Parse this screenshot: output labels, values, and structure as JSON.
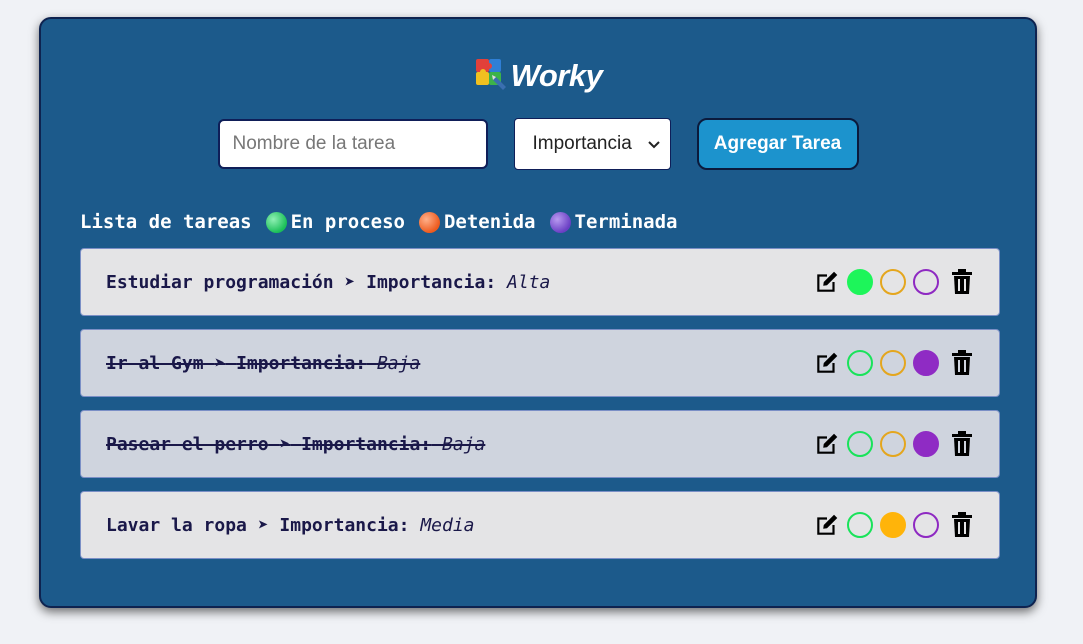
{
  "app": {
    "title": "Worky",
    "icon": "puzzle-logo-icon"
  },
  "form": {
    "task_placeholder": "Nombre de la tarea",
    "task_value": "",
    "importance_selected": "Importancia",
    "add_label": "Agregar Tarea"
  },
  "legend": {
    "title": "Lista de tareas",
    "in_process": "En proceso",
    "stopped": "Detenida",
    "done": "Terminada"
  },
  "tasks": [
    {
      "name": "Estudiar programación",
      "importance_label": "Importancia:",
      "importance": "Alta",
      "status": "in_process"
    },
    {
      "name": "Ir al Gym",
      "importance_label": "Importancia:",
      "importance": "Baja",
      "status": "done"
    },
    {
      "name": "Pasear el perro",
      "importance_label": "Importancia:",
      "importance": "Baja",
      "status": "done"
    },
    {
      "name": "Lavar la ropa",
      "importance_label": "Importancia:",
      "importance": "Media",
      "status": "stopped"
    }
  ],
  "colors": {
    "card_background": "#1c5a8b",
    "button": "#1c93cd",
    "in_process": "#1df55a",
    "stopped": "#ffb40a",
    "done": "#8f2bc4"
  },
  "icons": {
    "separator": "arrowhead-right-icon",
    "edit": "edit-icon",
    "delete": "trash-icon",
    "select": "chevron-down-icon"
  }
}
